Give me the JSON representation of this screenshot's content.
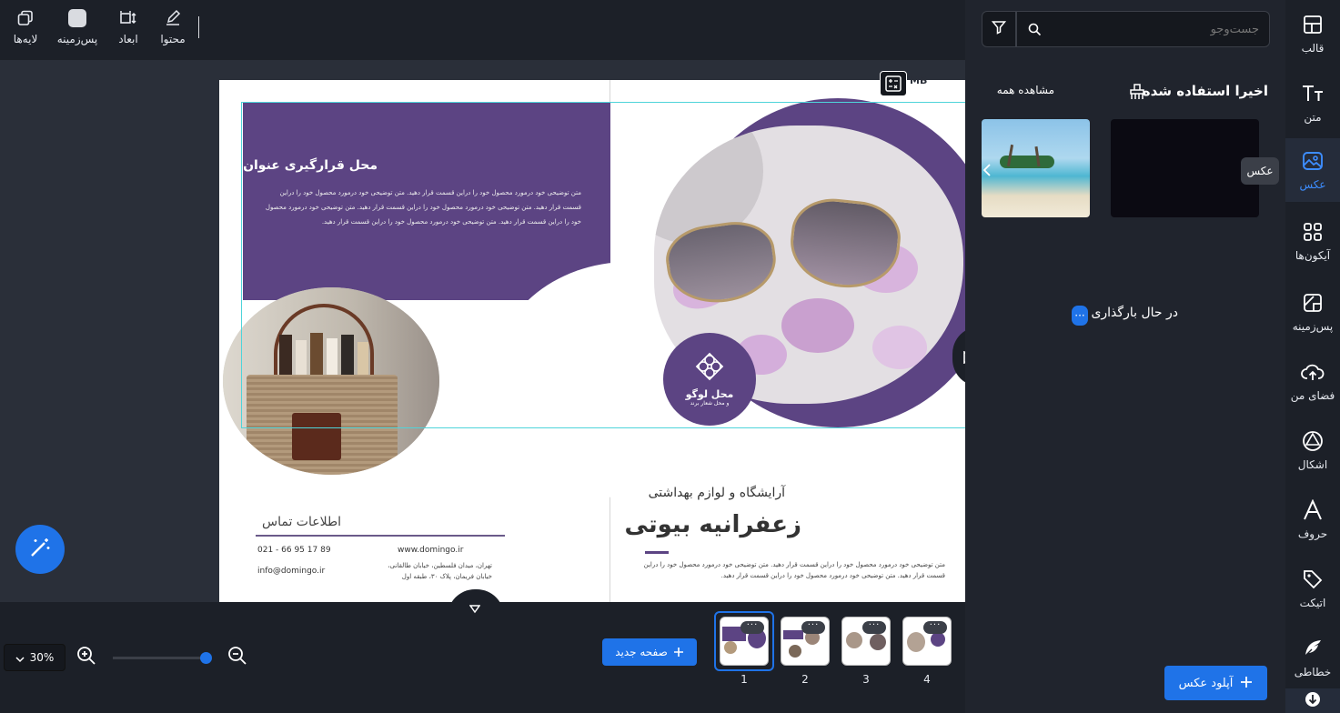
{
  "toolbar": {
    "layers_label": "لایه‌ها",
    "background_label": "پس‌زمینه",
    "dimensions_label": "ابعاد",
    "content_label": "محتوا"
  },
  "canvas": {
    "badge": "MB",
    "left_title": "محل قرارگیری عنوان",
    "left_paragraph": "متن توضیحی خود درمورد محصول خود را دراین قسمت قرار دهید. متن توضیحی خود درمورد محصول خود را دراین قسمت قرار دهید. متن توضیحی خود درمورد محصول خود را دراین قسمت قرار دهید. متن توضیحی خود درمورد محصول خود را دراین قسمت قرار دهید. متن توضیحی خود درمورد محصول خود را دراین قسمت قرار دهید.",
    "contact_title": "اطلاعات تماس",
    "phone": "021 - 66 95 17 89",
    "email": "info@domingo.ir",
    "website": "www.domingo.ir",
    "address": "تهران، میدان فلسطین، خیابان طالقانی، خیابان فریمان، پلاک ۳۰، طبقه اول",
    "logo_title": "محل لوگو",
    "logo_subtitle": "و محل شعار برند",
    "subtitle": "آرایشگاه و لوازم بهداشتی",
    "main_title": "زعفرانیه بیوتی",
    "right_paragraph": "متن توضیحی خود درمورد محصول خود را دراین قسمت قرار دهید. متن توضیحی خود درمورد محصول خود را دراین قسمت قرار دهید. متن توضیحی خود درمورد محصول خود را دراین قسمت قرار دهید."
  },
  "bottom": {
    "zoom": "30%",
    "new_page_label": "صفحه جدید",
    "pages": [
      "1",
      "2",
      "3",
      "4"
    ],
    "selected_page": "1",
    "thumb_menu": "···"
  },
  "panel": {
    "search_placeholder": "جست‌وجو",
    "recent_title": "اخیرا استفاده شده",
    "view_all": "مشاهده همه",
    "loading_text": "در حال بارگذاری",
    "loading_dots": "···",
    "upload_label": "آپلود عکس",
    "tooltip": "عکس"
  },
  "rail": {
    "items": [
      {
        "label": "قالب",
        "icon": "template-icon"
      },
      {
        "label": "متن",
        "icon": "text-icon"
      },
      {
        "label": "عکس",
        "icon": "image-icon"
      },
      {
        "label": "آیکون‌ها",
        "icon": "icons-icon"
      },
      {
        "label": "پس‌زمینه",
        "icon": "background-icon"
      },
      {
        "label": "فضای من",
        "icon": "cloud-upload-icon"
      },
      {
        "label": "اشکال",
        "icon": "shapes-icon"
      },
      {
        "label": "حروف",
        "icon": "letters-icon"
      },
      {
        "label": "اتیکت",
        "icon": "tag-icon"
      },
      {
        "label": "خطاطی",
        "icon": "feather-icon"
      }
    ],
    "active": "عکس"
  },
  "colors": {
    "accent": "#1f73e8",
    "purple": "#5c4483",
    "guide": "#4fd4da"
  }
}
